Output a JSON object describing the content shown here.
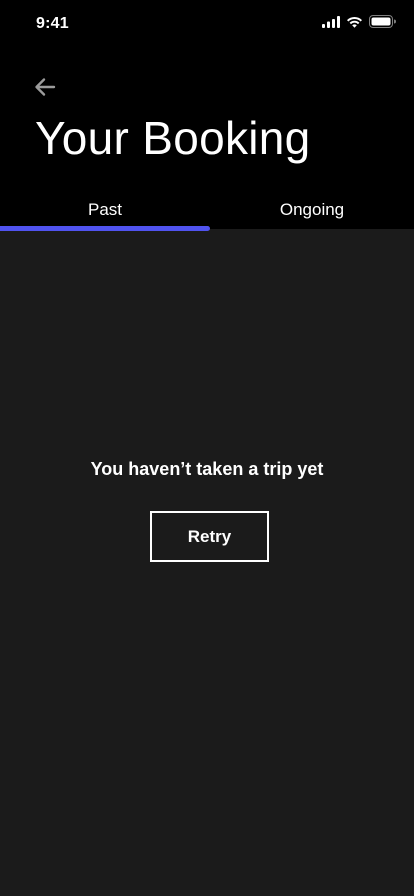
{
  "status_bar": {
    "time": "9:41",
    "icons": [
      "cellular-signal-icon",
      "wifi-icon",
      "battery-icon"
    ]
  },
  "header": {
    "back_icon": "arrow-left-icon",
    "title": "Your Booking"
  },
  "tabs": [
    {
      "label": "Past",
      "active": true
    },
    {
      "label": "Ongoing",
      "active": false
    }
  ],
  "empty_state": {
    "message": "You haven’t taken a trip yet",
    "retry_label": "Retry"
  },
  "colors": {
    "header_bg": "#000000",
    "content_bg": "#1b1b1b",
    "tab_indicator": "#5053ef",
    "text": "#ffffff",
    "back_icon": "#9b9b9b"
  }
}
